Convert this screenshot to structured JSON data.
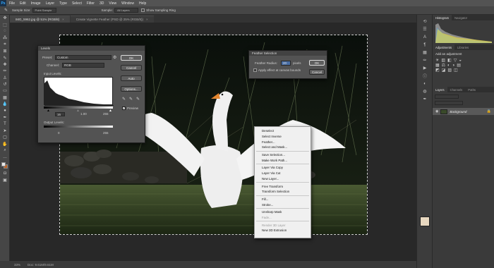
{
  "menubar": {
    "logo": "Ps",
    "items": [
      "File",
      "Edit",
      "Image",
      "Layer",
      "Type",
      "Select",
      "Filter",
      "3D",
      "View",
      "Window",
      "Help"
    ]
  },
  "options": {
    "sample_size_label": "Sample Size:",
    "sample_size_value": "Point Sample",
    "sample_label": "Sample:",
    "sample_value": "All Layers",
    "show_ring": "Show Sampling Ring"
  },
  "tabs": [
    {
      "label": "IMG_5962.jpg @ 51% (RGB/8)",
      "active": true
    },
    {
      "label": "Create Vignette Feather (PSD @ 25% (RGB/8))",
      "active": false
    }
  ],
  "status": {
    "zoom": "33%",
    "doc": "Doc: 9.61M/9.61M"
  },
  "panels": {
    "tabs1": [
      "Histogram",
      "Navigator"
    ],
    "tabs2": [
      "Adjustments",
      "Libraries"
    ],
    "add_adjustment": "Add an adjustment",
    "tabs3": [
      "Layers",
      "Channels",
      "Paths"
    ],
    "layer_name": "Background"
  },
  "levels": {
    "title": "Levels",
    "preset_label": "Preset:",
    "preset_value": "Custom",
    "channel_label": "Channel:",
    "channel_value": "RGB",
    "input_label": "Input Levels:",
    "input_values": [
      "16",
      "1.00",
      "255"
    ],
    "output_label": "Output Levels:",
    "output_values": [
      "0",
      "255"
    ],
    "buttons": [
      "OK",
      "Cancel",
      "Auto",
      "Options..."
    ],
    "preview_label": "Preview"
  },
  "feather": {
    "title": "Feather Selection",
    "radius_label": "Feather Radius:",
    "radius_value": "20",
    "unit": "pixels",
    "apply_label": "Apply effect at canvas bounds",
    "ok": "OK",
    "cancel": "Cancel"
  },
  "context_menu": {
    "groups": [
      [
        "Deselect",
        "Select Inverse",
        "Feather...",
        "Select and Mask..."
      ],
      [
        "Save Selection...",
        "Make Work Path..."
      ],
      [
        "Layer Via Copy",
        "Layer Via Cut",
        "New Layer..."
      ],
      [
        "Free Transform",
        "Transform Selection"
      ],
      [
        "Fill...",
        "Stroke..."
      ],
      [
        "Unsharp Mask",
        "Fade..."
      ],
      [
        "Render 3D Layer",
        "New 3D Extrusion"
      ]
    ],
    "disabled": [
      "Fade...",
      "Render 3D Layer"
    ]
  },
  "colors": {
    "accent": "#31a8ff",
    "bg": "#3b3b3b",
    "panel": "#535353",
    "menu": "#f0f0f0"
  }
}
